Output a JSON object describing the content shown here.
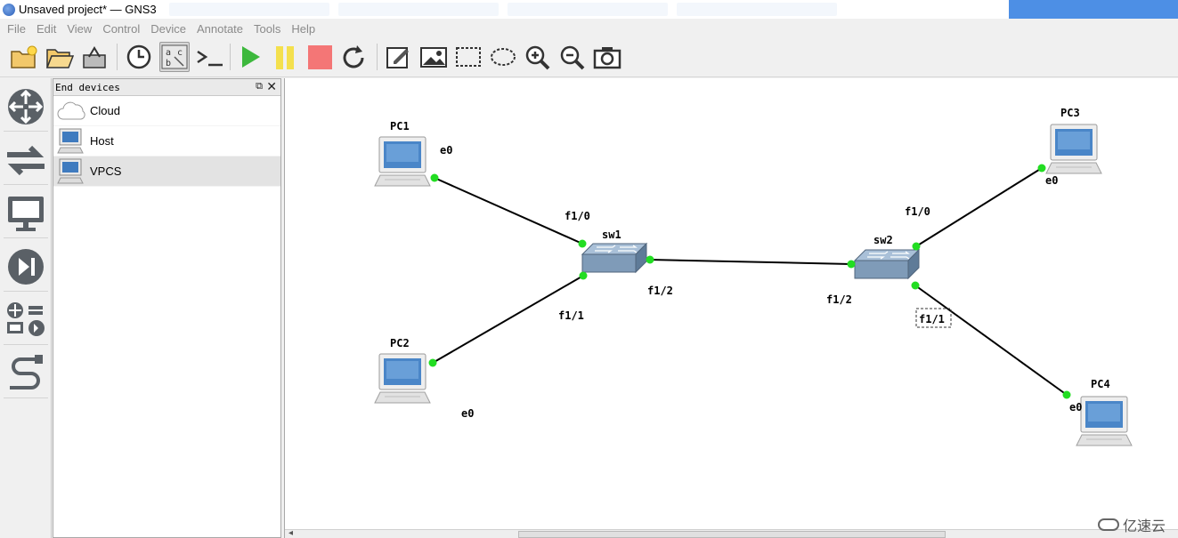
{
  "window": {
    "title": "Unsaved project* — GNS3"
  },
  "menu": [
    "File",
    "Edit",
    "View",
    "Control",
    "Device",
    "Annotate",
    "Tools",
    "Help"
  ],
  "toolbar": {
    "items": [
      "new-project",
      "open-project",
      "save-project",
      "snapshot",
      "show-interface-labels",
      "console-all",
      "start-all",
      "suspend-all",
      "stop-all",
      "reload-all",
      "add-note",
      "insert-image",
      "draw-rectangle",
      "draw-ellipse",
      "zoom-in",
      "zoom-out",
      "screenshot"
    ],
    "active": "show-interface-labels",
    "labels_glyph": "a c b",
    "console_glyph": ">_"
  },
  "rail": [
    "routers",
    "switches",
    "end-devices",
    "security-devices",
    "all-devices",
    "add-link"
  ],
  "dock": {
    "title": "End devices",
    "float_glyph": "⧉",
    "close_glyph": "✕",
    "items": [
      {
        "label": "Cloud",
        "icon": "cloud-icon",
        "selected": false
      },
      {
        "label": "Host",
        "icon": "host-icon",
        "selected": false
      },
      {
        "label": "VPCS",
        "icon": "vpcs-icon",
        "selected": true
      }
    ]
  },
  "topology": {
    "nodes": [
      {
        "name": "PC1",
        "type": "pc"
      },
      {
        "name": "PC2",
        "type": "pc"
      },
      {
        "name": "PC3",
        "type": "pc"
      },
      {
        "name": "PC4",
        "type": "pc"
      },
      {
        "name": "sw1",
        "type": "switch"
      },
      {
        "name": "sw2",
        "type": "switch"
      }
    ],
    "links": [
      {
        "a": "PC1",
        "a_port": "e0",
        "b": "sw1",
        "b_port": "f1/0"
      },
      {
        "a": "PC2",
        "a_port": "e0",
        "b": "sw1",
        "b_port": "f1/1"
      },
      {
        "a": "sw1",
        "a_port": "f1/2",
        "b": "sw2",
        "b_port": "f1/2"
      },
      {
        "a": "sw2",
        "a_port": "f1/0",
        "b": "PC3",
        "b_port": "e0"
      },
      {
        "a": "sw2",
        "a_port": "f1/1",
        "b": "PC4",
        "b_port": "e0"
      }
    ],
    "highlighted_label": "f1/1",
    "link_color": "#000000",
    "port_up_color": "#22dd22"
  },
  "watermark": {
    "text": "亿速云"
  },
  "colors": {
    "canvas": "#ffffff",
    "chrome": "#f0f0f0",
    "stop": "#f47676",
    "start": "#3db83d",
    "suspend": "#f4e04d"
  }
}
